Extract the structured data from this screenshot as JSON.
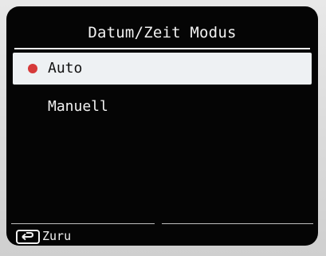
{
  "screen": {
    "title": "Datum/Zeit Modus",
    "items": [
      {
        "label": "Auto",
        "selected": true
      },
      {
        "label": "Manuell",
        "selected": false
      }
    ],
    "footer": {
      "back_label": "Zuru"
    }
  },
  "colors": {
    "background": "#050505",
    "selected_row": "#eef1f3",
    "radio_dot": "#d63a3a",
    "text": "#f2f2f2"
  },
  "icons": {
    "selected_marker": "radio-dot-icon",
    "back": "return-arrow-icon"
  }
}
